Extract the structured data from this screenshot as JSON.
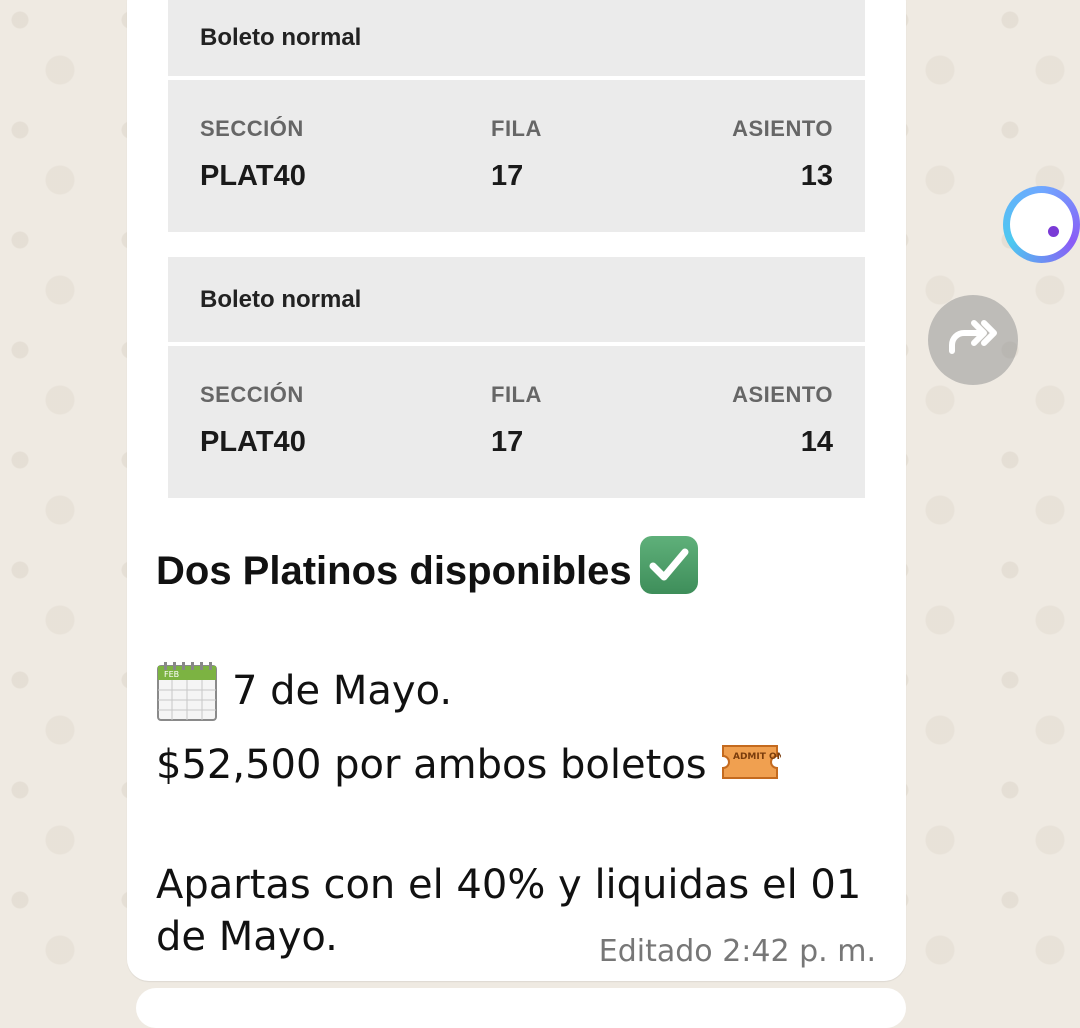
{
  "tickets": [
    {
      "type": "Boleto normal",
      "section_label": "SECCIÓN",
      "row_label": "FILA",
      "seat_label": "ASIENTO",
      "section": "PLAT40",
      "row": "17",
      "seat": "13"
    },
    {
      "type": "Boleto normal",
      "section_label": "SECCIÓN",
      "row_label": "FILA",
      "seat_label": "ASIENTO",
      "section": "PLAT40",
      "row": "17",
      "seat": "14"
    }
  ],
  "message": {
    "headline": "Dos Platinos disponibles",
    "headline_emoji": "check-mark-button-icon",
    "date_emoji": "calendar-icon",
    "date_text": "7 de Mayo.",
    "price_text": "$52,500 por ambos boletos",
    "price_emoji": "admission-ticket-icon",
    "payment_line1": "Apartas con el 40% y liquidas el 01",
    "payment_line2": "de Mayo.",
    "edited_label": "Editado",
    "time": "2:42 p. m."
  },
  "calendar_icon_text": "FEB",
  "ticket_icon_text": "ADMIT ONE",
  "colors": {
    "bubble": "#ffffff",
    "wallpaper": "#efeae2",
    "ticket_bg": "#ebebeb",
    "assistant_dot": "#7a3ad6"
  }
}
